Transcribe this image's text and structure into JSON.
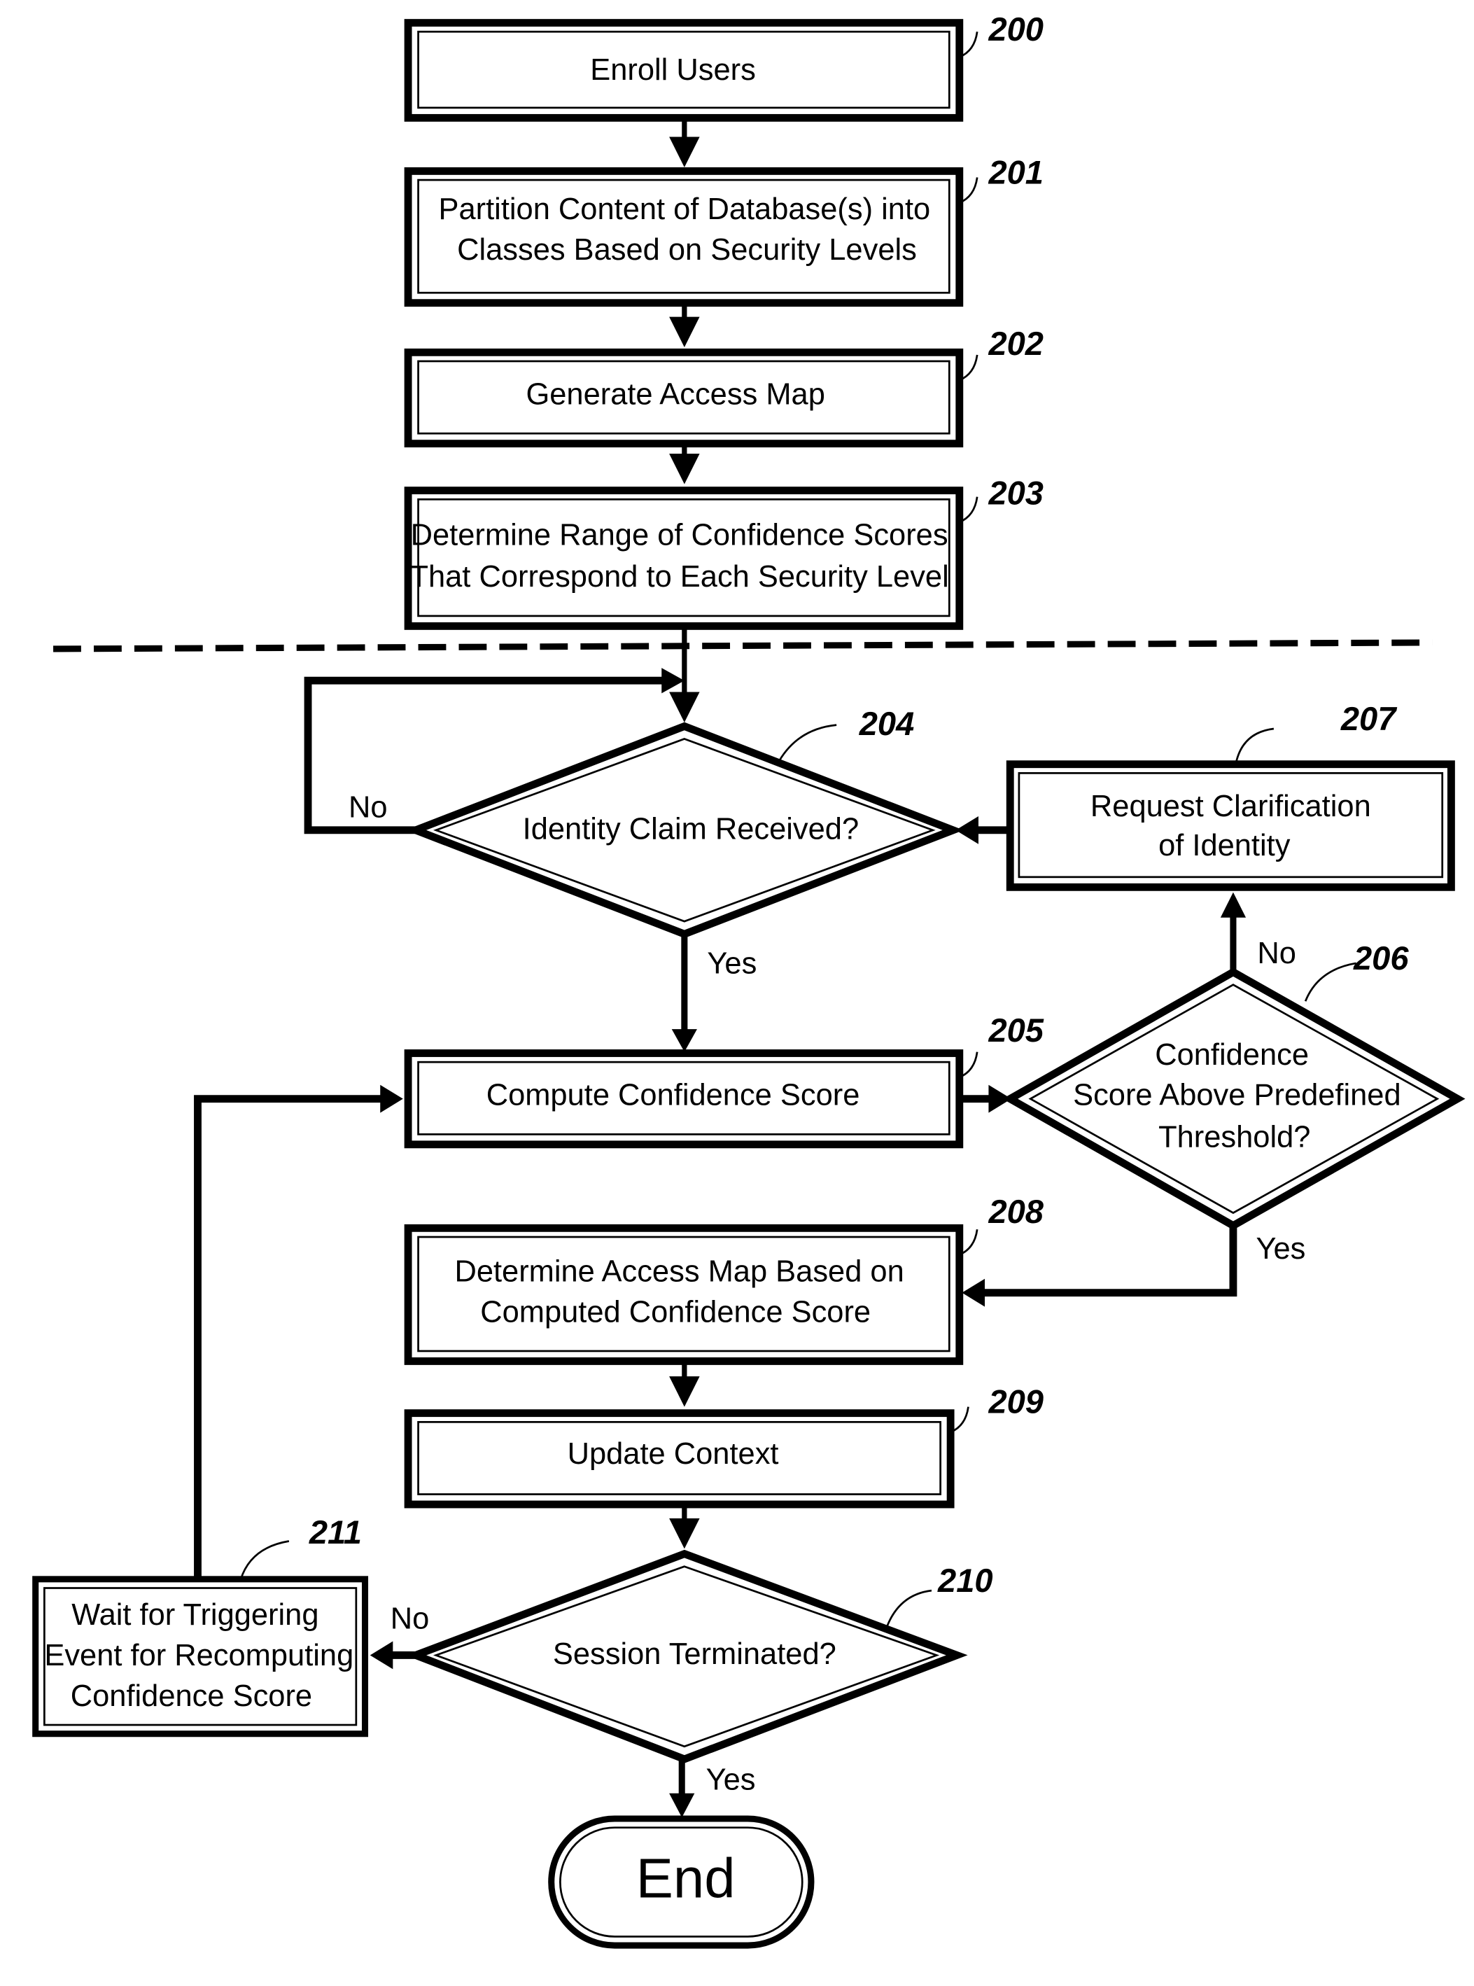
{
  "figure": {
    "steps": {
      "s200": {
        "ref": "200",
        "lines": [
          "Enroll Users"
        ]
      },
      "s201": {
        "ref": "201",
        "lines": [
          "Partition Content of Database(s) into",
          "Classes Based on Security Levels"
        ]
      },
      "s202": {
        "ref": "202",
        "lines": [
          "Generate Access Map"
        ]
      },
      "s203": {
        "ref": "203",
        "lines": [
          "Determine Range of Confidence Scores",
          "That Correspond to Each Security Level"
        ]
      },
      "s204": {
        "ref": "204",
        "lines": [
          "Identity Claim Received?"
        ]
      },
      "s205": {
        "ref": "205",
        "lines": [
          "Compute Confidence Score"
        ]
      },
      "s206": {
        "ref": "206",
        "lines": [
          "Confidence",
          "Score Above Predefined",
          "Threshold?"
        ]
      },
      "s207": {
        "ref": "207",
        "lines": [
          "Request Clarification",
          "of Identity"
        ]
      },
      "s208": {
        "ref": "208",
        "lines": [
          "Determine Access Map Based on",
          "Computed Confidence Score"
        ]
      },
      "s209": {
        "ref": "209",
        "lines": [
          "Update Context"
        ]
      },
      "s210": {
        "ref": "210",
        "lines": [
          "Session Terminated?"
        ]
      },
      "s211": {
        "ref": "211",
        "lines": [
          "Wait for Triggering",
          "Event for Recomputing",
          "Confidence Score"
        ]
      },
      "end": {
        "lines": [
          "End"
        ]
      }
    },
    "branch_labels": {
      "yes": "Yes",
      "no": "No"
    }
  }
}
